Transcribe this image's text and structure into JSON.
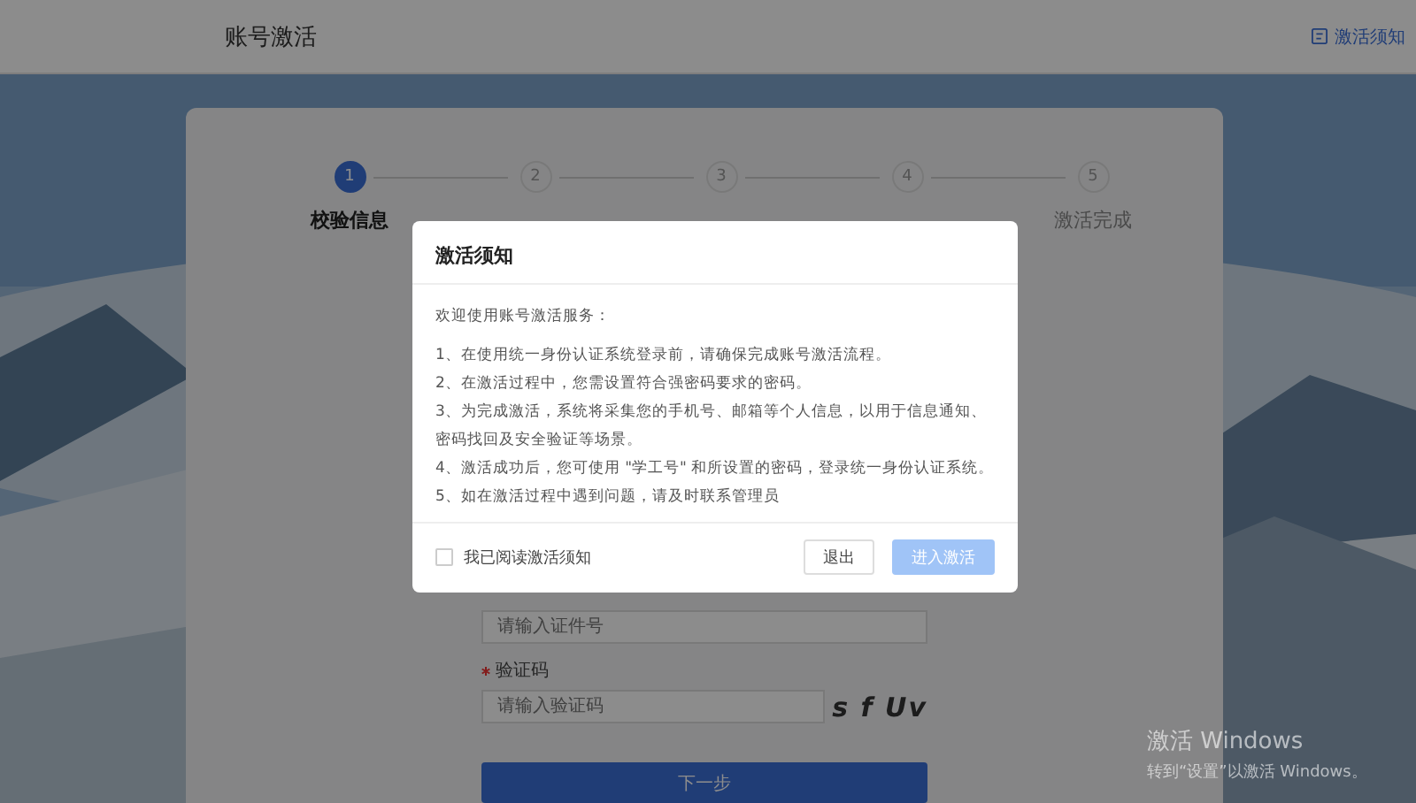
{
  "header": {
    "title": "账号激活",
    "notice_link": "激活须知"
  },
  "steps": [
    {
      "number": "1",
      "label": "校验信息",
      "selected": true
    },
    {
      "number": "2",
      "selected": false
    },
    {
      "number": "3",
      "selected": false
    },
    {
      "number": "4",
      "selected": false
    },
    {
      "number": "5",
      "label": "激活完成",
      "selected": false
    }
  ],
  "form": {
    "id_field": {
      "placeholder": "请输入证件号"
    },
    "captcha_label": {
      "text": "验证码",
      "required": true
    },
    "captcha_field": {
      "placeholder": "请输入验证码"
    },
    "captcha_image": "s f Uv",
    "next_button": "下一步"
  },
  "dialog": {
    "title": "激活须知",
    "intro": "欢迎使用账号激活服务：",
    "items": [
      "1、在使用统一身份认证系统登录前，请确保完成账号激活流程。",
      "2、在激活过程中，您需设置符合强密码要求的密码。",
      "3、为完成激活，系统将采集您的手机号、邮箱等个人信息，以用于信息通知、密码找回及安全验证等场景。",
      "4、激活成功后，您可使用 \"学工号\" 和所设置的密码，登录统一身份认证系统。",
      "5、如在激活过程中遇到问题，请及时联系管理员"
    ],
    "agree": {
      "label": "我已阅读激活须知",
      "checked": false
    },
    "buttons": [
      {
        "label": "退出",
        "kind": "default",
        "disabled": false
      },
      {
        "label": "进入激活",
        "kind": "primary",
        "disabled": true
      }
    ]
  },
  "os_notice": {
    "title": "激活 Windows",
    "text": "转到“设置”以激活 Windows。"
  }
}
